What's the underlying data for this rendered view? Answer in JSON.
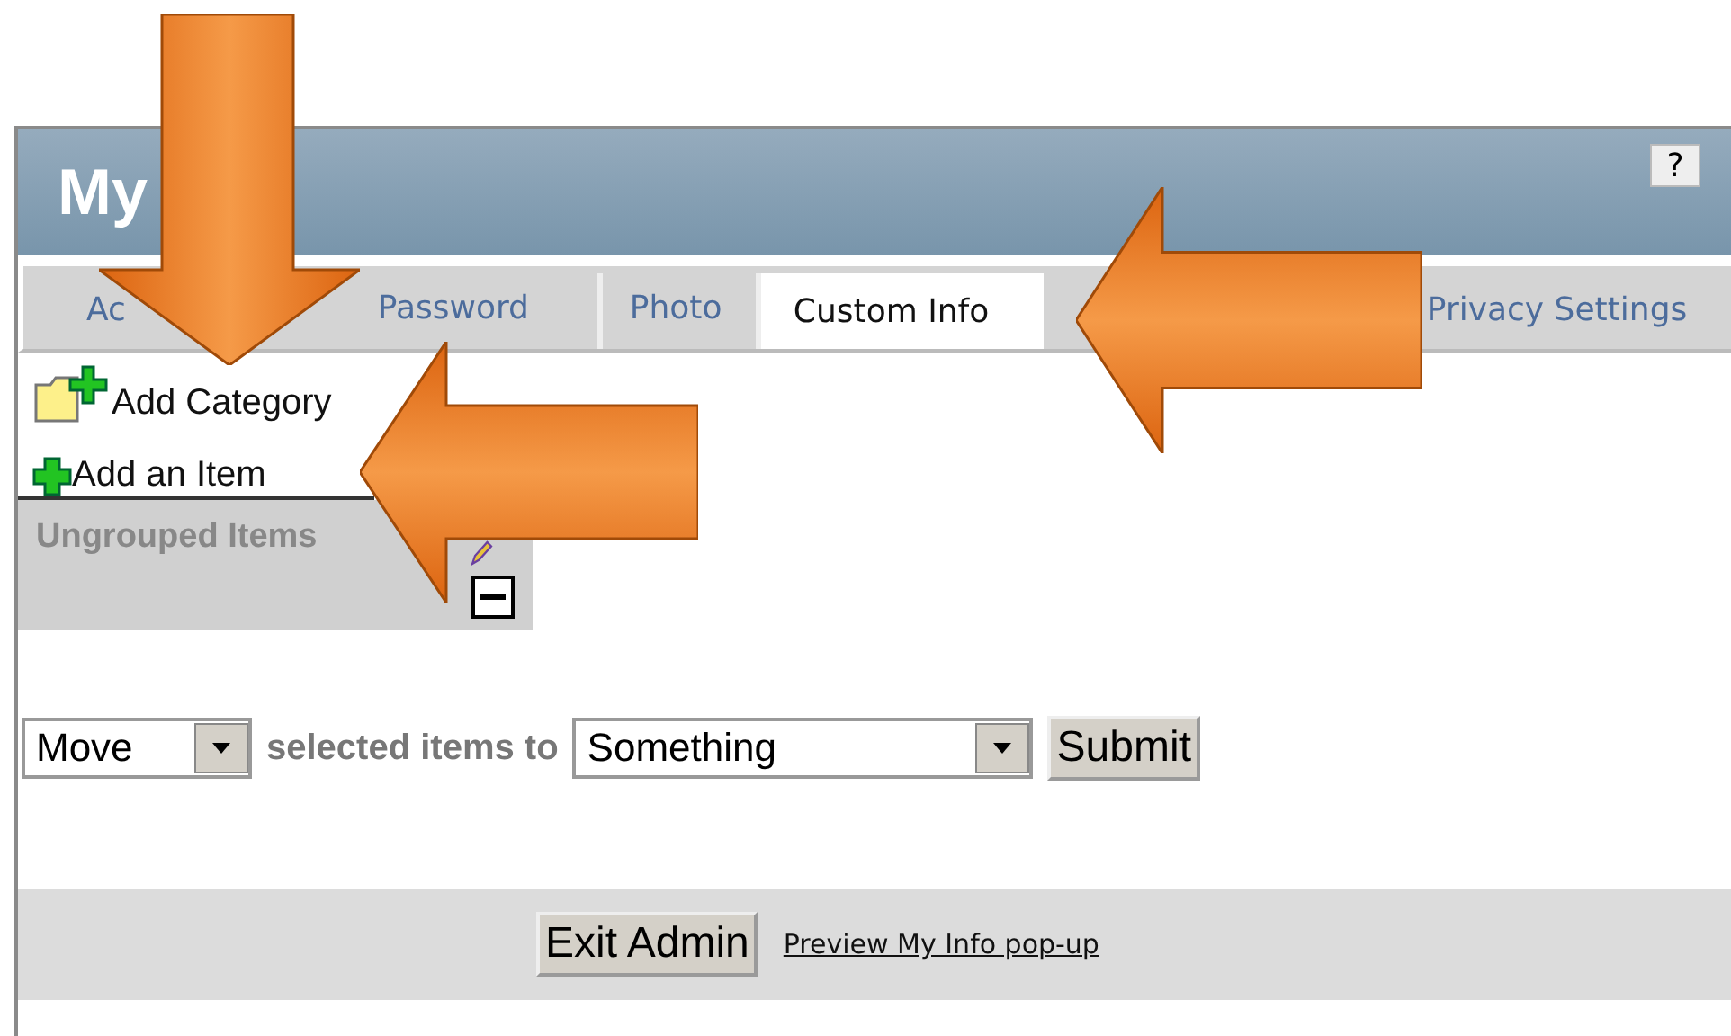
{
  "header": {
    "title": "My",
    "help_button": "?"
  },
  "tabs": [
    {
      "label": "Ac",
      "selected": false
    },
    {
      "label": "Password",
      "selected": false
    },
    {
      "label": "Photo",
      "selected": false
    },
    {
      "label": "Custom Info",
      "selected": true
    },
    {
      "label": "Privacy Settings",
      "selected": false
    }
  ],
  "links": {
    "add_category": "Add Category",
    "add_item": "Add an Item"
  },
  "group": {
    "title": "Ungrouped Items",
    "expanded": true
  },
  "move_form": {
    "action": "Move",
    "label": "selected items to",
    "target": "Something",
    "submit": "Submit"
  },
  "footer": {
    "exit_button": "Exit Admin",
    "preview_link": "Preview My Info pop-up"
  },
  "annotations": [
    {
      "kind": "down"
    },
    {
      "kind": "left"
    },
    {
      "kind": "left"
    }
  ]
}
